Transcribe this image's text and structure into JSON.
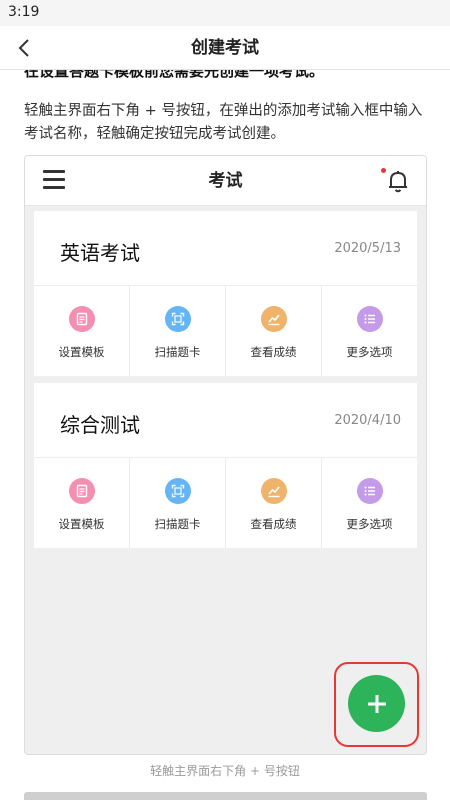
{
  "status_bar": {
    "time": "3:19"
  },
  "nav": {
    "title": "创建考试"
  },
  "cut_text": "在设置答题卡模板前您需要先创建一项考试。",
  "description": "轻触主界面右下角 + 号按钮，在弹出的添加考试输入框中输入考试名称，轻触确定按钮完成考试创建。",
  "phone": {
    "title": "考试",
    "exams": [
      {
        "name": "英语考试",
        "date": "2020/5/13",
        "actions": [
          {
            "label": "设置模板",
            "icon": "template-icon",
            "color": "#f48fb1"
          },
          {
            "label": "扫描题卡",
            "icon": "scan-icon",
            "color": "#64b5f6"
          },
          {
            "label": "查看成绩",
            "icon": "chart-icon",
            "color": "#f0b36b"
          },
          {
            "label": "更多选项",
            "icon": "list-icon",
            "color": "#c49be8"
          }
        ]
      },
      {
        "name": "综合测试",
        "date": "2020/4/10",
        "actions": [
          {
            "label": "设置模板",
            "icon": "template-icon",
            "color": "#f48fb1"
          },
          {
            "label": "扫描题卡",
            "icon": "scan-icon",
            "color": "#64b5f6"
          },
          {
            "label": "查看成绩",
            "icon": "chart-icon",
            "color": "#f0b36b"
          },
          {
            "label": "更多选项",
            "icon": "list-icon",
            "color": "#c49be8"
          }
        ]
      }
    ]
  },
  "caption": "轻触主界面右下角 + 号按钮",
  "colors": {
    "fab": "#2db45a",
    "highlight": "#e53935",
    "notification_dot": "#e53935"
  }
}
